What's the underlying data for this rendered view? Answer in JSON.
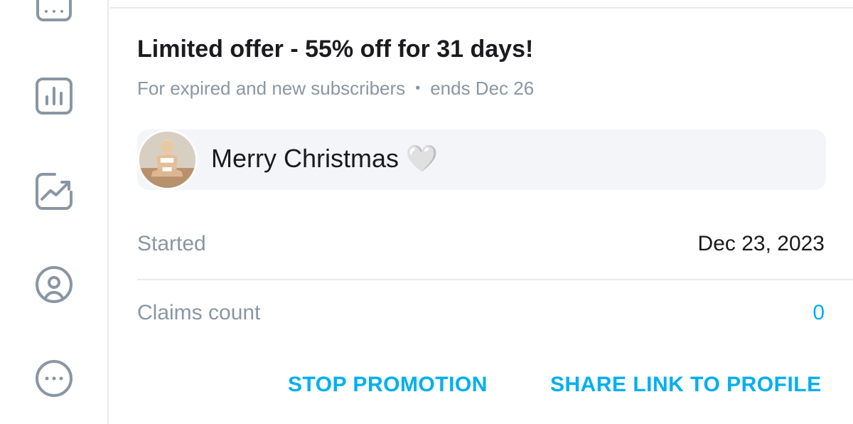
{
  "sidebar": {
    "items": [
      {
        "icon": "calendar-icon"
      },
      {
        "icon": "bar-chart-icon"
      },
      {
        "icon": "trending-chart-icon"
      },
      {
        "icon": "profile-circle-icon"
      },
      {
        "icon": "more-horizontal-icon"
      }
    ]
  },
  "promotion": {
    "title": "Limited offer - 55% off for 31 days!",
    "audience": "For expired and new subscribers",
    "separator": "•",
    "ends": "ends Dec 26",
    "message": "Merry Christmas",
    "message_emoji": "🤍",
    "started_label": "Started",
    "started_value": "Dec 23, 2023",
    "claims_label": "Claims count",
    "claims_value": "0"
  },
  "actions": {
    "stop_label": "STOP PROMOTION",
    "share_label": "SHARE LINK TO PROFILE"
  },
  "colors": {
    "accent": "#00aff0",
    "muted_text": "#8a96a3",
    "icon_gray": "#8a96a3",
    "message_bg": "#f4f5f8"
  }
}
